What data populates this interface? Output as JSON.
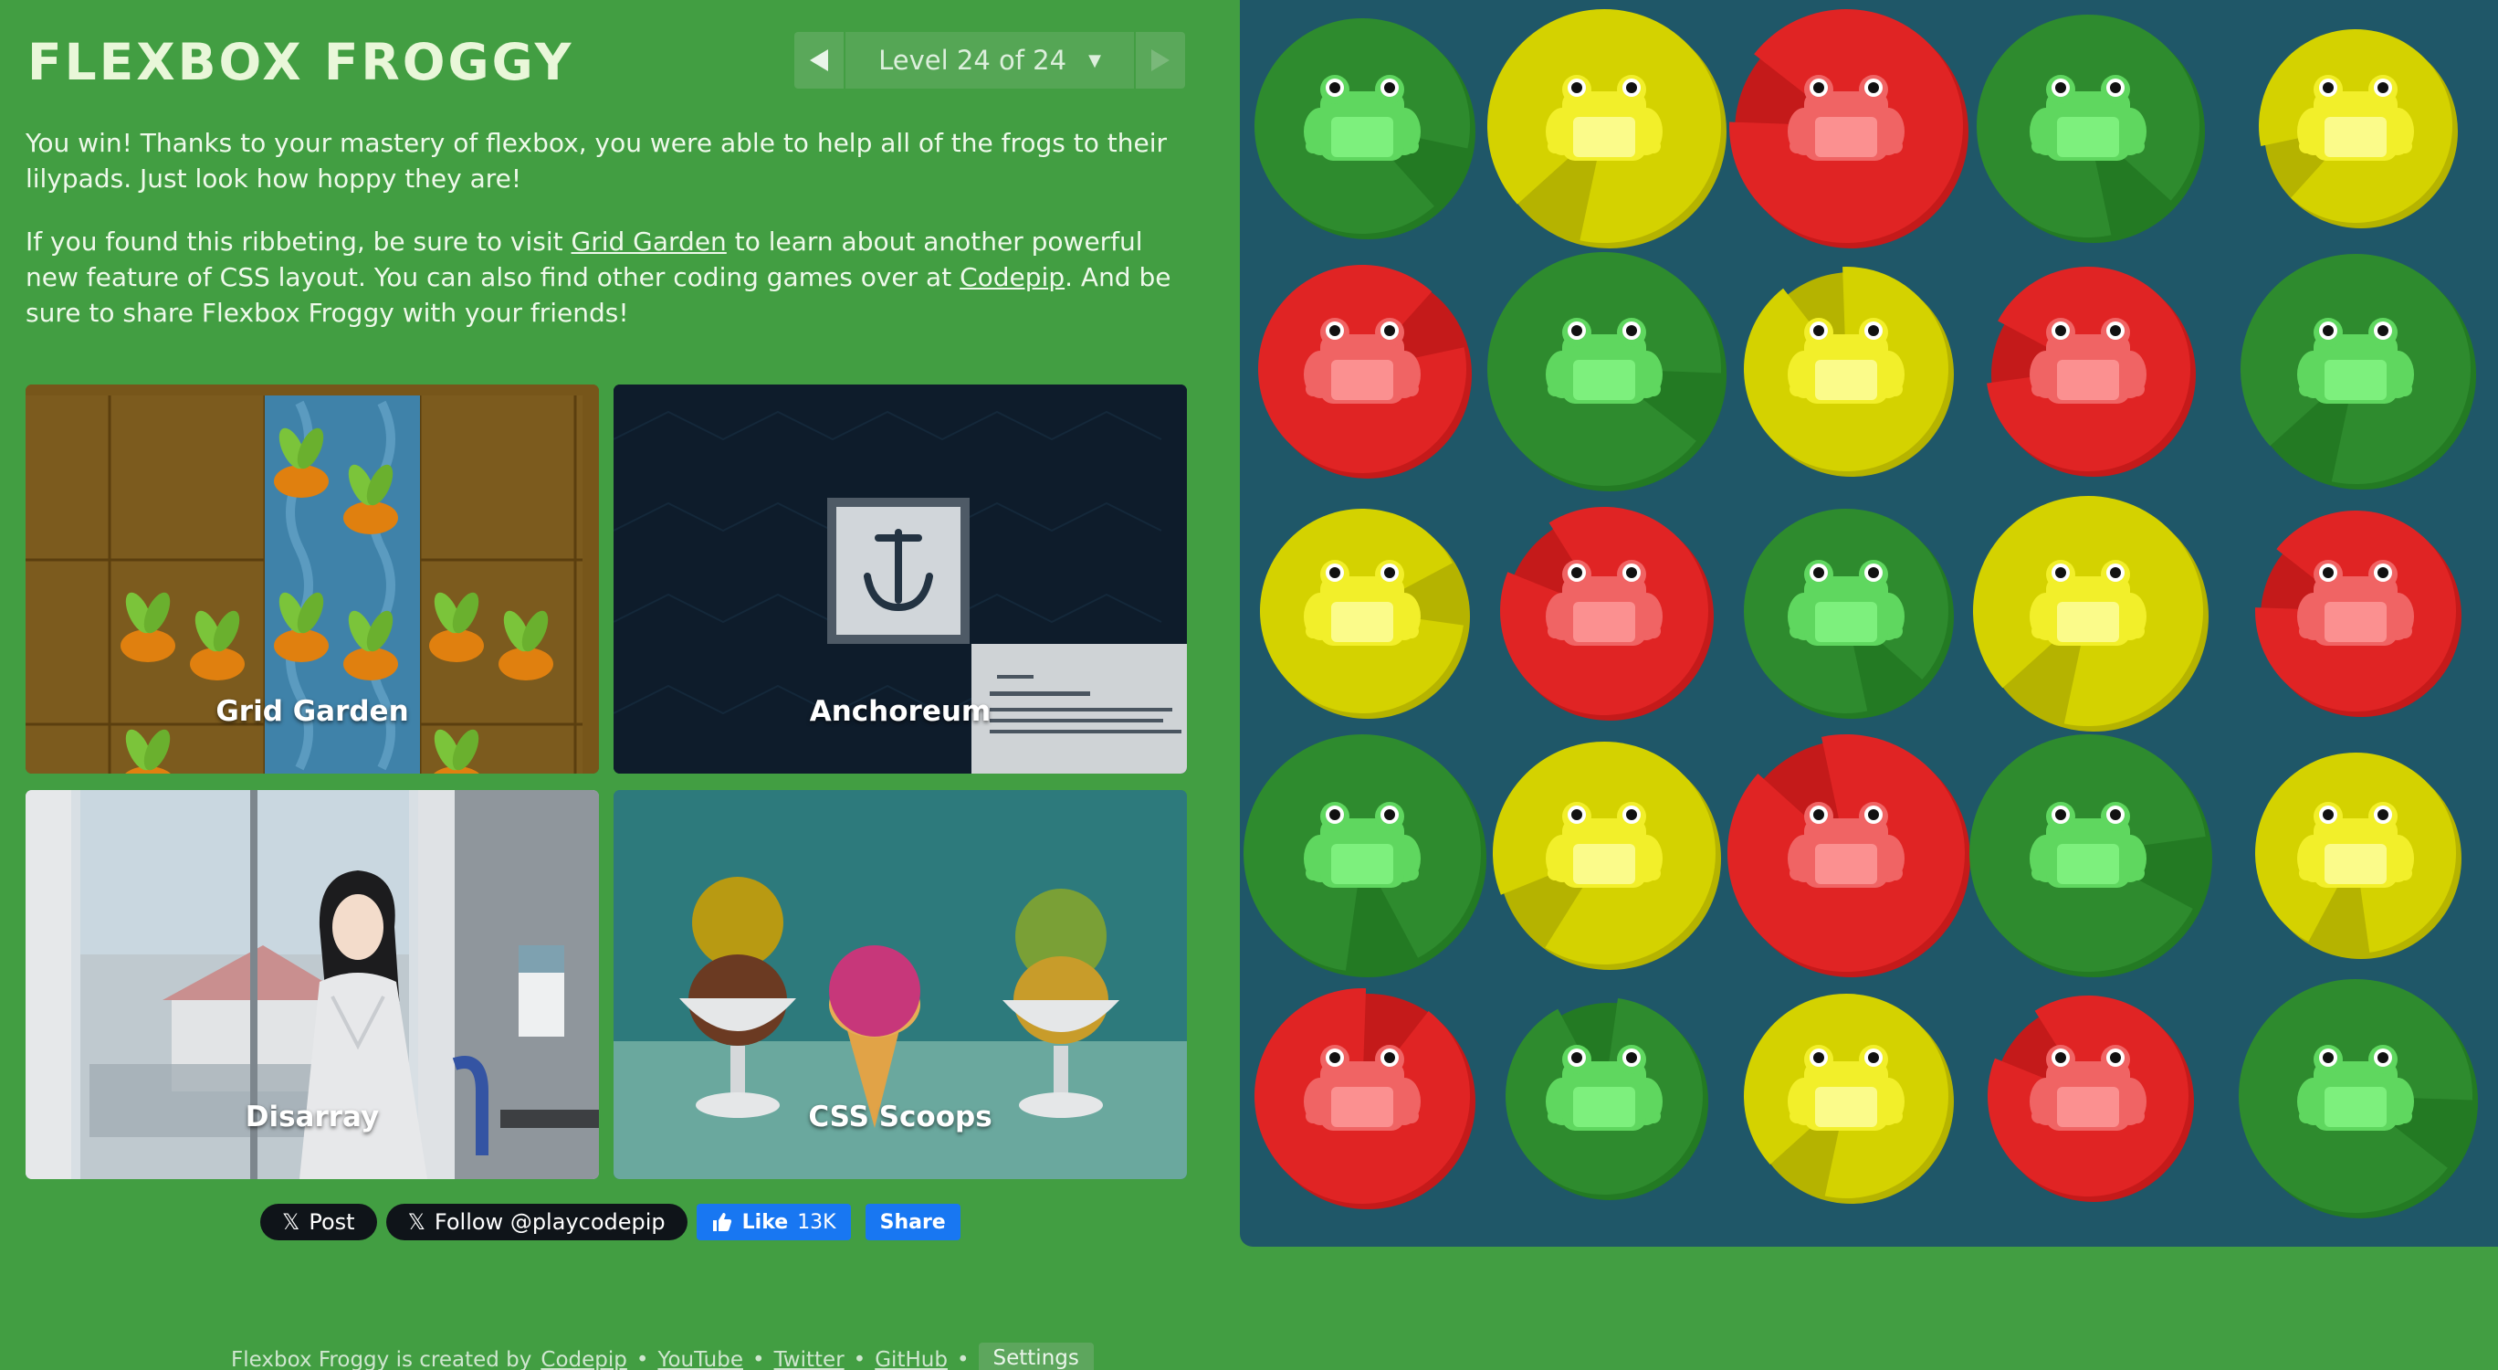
{
  "title": "FLEXBOX FROGGY",
  "level_nav": {
    "label": "Level 24 of 24",
    "caret": "▼"
  },
  "win_text": "You win! Thanks to your mastery of flexbox, you were able to help all of the frogs to their lilypads. Just look how hoppy they are!",
  "promo": {
    "part1": "If you found this ribbeting, be sure to visit ",
    "link1": "Grid Garden",
    "part2": " to learn about another powerful new feature of CSS layout. You can also find other coding games over at ",
    "link2": "Codepip",
    "part3": ". And be sure to share Flexbox Froggy with your friends!"
  },
  "games": [
    {
      "name": "Grid Garden"
    },
    {
      "name": "Anchoreum"
    },
    {
      "name": "Disarray"
    },
    {
      "name": "CSS Scoops"
    }
  ],
  "social": {
    "post": "Post",
    "follow": "Follow @playcodepip",
    "like": "Like",
    "like_count": "13K",
    "share": "Share"
  },
  "footer": {
    "prefix": "Flexbox Froggy is created by",
    "codepip": "Codepip",
    "sep": "•",
    "youtube": "YouTube",
    "twitter": "Twitter",
    "github": "GitHub",
    "settings": "Settings"
  },
  "colors": {
    "background": "#429e42",
    "pond": "#1f5768",
    "green_pad": "#2e8b2e",
    "yellow_pad": "#d4d200",
    "red_pad": "#e02424",
    "green_frog": "#5fd75f",
    "yellow_frog": "#f2ef2a",
    "red_frog": "#f06464"
  },
  "pond": {
    "rows": [
      [
        "green",
        "yellow",
        "red",
        "green",
        "yellow"
      ],
      [
        "red",
        "green",
        "yellow",
        "red",
        "green"
      ],
      [
        "yellow",
        "red",
        "green",
        "yellow",
        "red"
      ],
      [
        "green",
        "yellow",
        "red",
        "green",
        "yellow"
      ],
      [
        "red",
        "green",
        "yellow",
        "red",
        "green"
      ]
    ]
  }
}
